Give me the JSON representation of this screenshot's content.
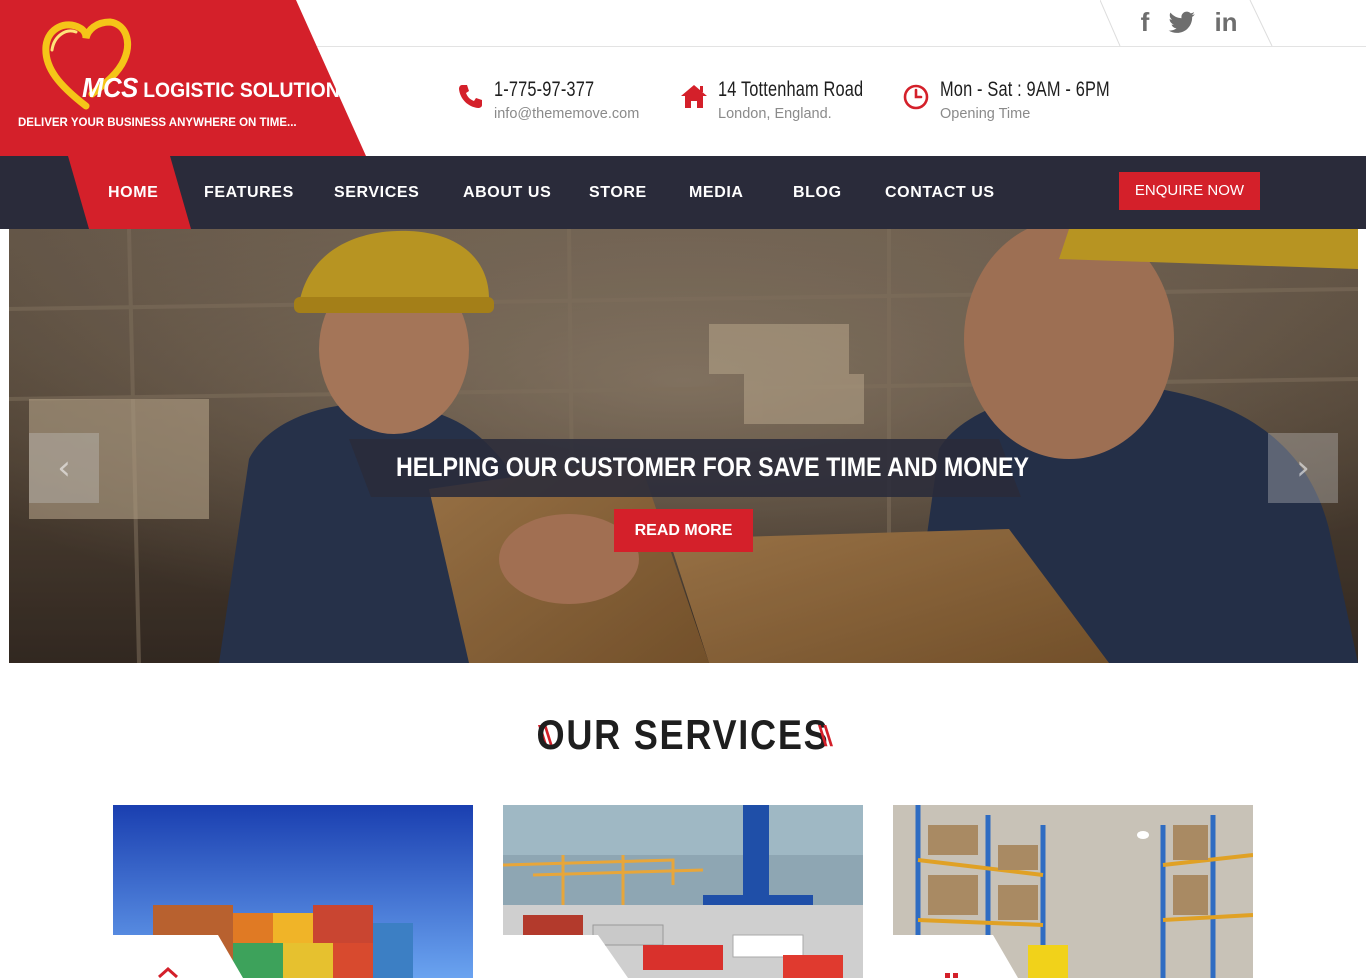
{
  "brand": {
    "name_strong": "MCS",
    "name_rest": " LOGISTIC SOLUTION",
    "tagline": "DELIVER YOUR BUSINESS ANYWHERE ON TIME...",
    "accent": "#d4202a",
    "dark": "#2a2b3a",
    "logo_gold": "#f5c518"
  },
  "social": {
    "icons": [
      "facebook-icon",
      "twitter-icon",
      "linkedin-icon"
    ],
    "facebook": "f",
    "linkedin": "in"
  },
  "contacts": [
    {
      "icon": "phone-icon",
      "main": "1-775-97-377",
      "sub": "info@thememove.com"
    },
    {
      "icon": "home-icon",
      "main": "14 Tottenham Road",
      "sub": "London, England."
    },
    {
      "icon": "clock-icon",
      "main": "Mon - Sat : 9AM - 6PM",
      "sub": "Opening Time"
    }
  ],
  "nav": {
    "items": [
      "HOME",
      "FEATURES",
      "SERVICES",
      "ABOUT US",
      "STORE",
      "MEDIA",
      "BLOG",
      "CONTACT US"
    ],
    "active": "HOME",
    "cta": "ENQUIRE NOW"
  },
  "hero": {
    "headline": "HELPING OUR CUSTOMER FOR SAVE TIME AND MONEY",
    "button": "READ MORE",
    "prev": "‹",
    "next": "›"
  },
  "services": {
    "title": "OUR SERVICES",
    "deco": "\\\\",
    "cards": [
      "container-yard-image",
      "port-crane-image",
      "warehouse-image"
    ]
  }
}
